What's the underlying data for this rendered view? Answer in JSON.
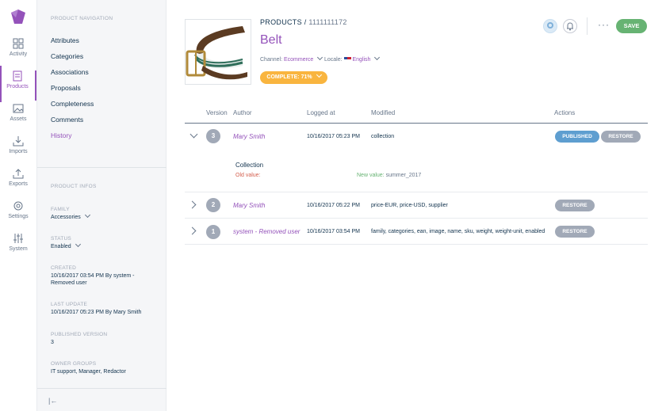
{
  "mainmenu": {
    "items": [
      {
        "label": "Activity",
        "icon": "dashboard-icon"
      },
      {
        "label": "Products",
        "icon": "products-icon"
      },
      {
        "label": "Assets",
        "icon": "image-icon"
      },
      {
        "label": "Imports",
        "icon": "download-icon"
      },
      {
        "label": "Exports",
        "icon": "upload-icon"
      },
      {
        "label": "Settings",
        "icon": "gear-icon"
      },
      {
        "label": "System",
        "icon": "sliders-icon"
      }
    ],
    "accent": "#9452ba"
  },
  "colnav": {
    "nav_title": "PRODUCT NAVIGATION",
    "links": [
      "Attributes",
      "Categories",
      "Associations",
      "Proposals",
      "Completeness",
      "Comments",
      "History"
    ],
    "infos_title": "PRODUCT INFOS",
    "family_label": "FAMILY",
    "family_value": "Accessories",
    "status_label": "STATUS",
    "status_value": "Enabled",
    "created_label": "CREATED",
    "created_value": "10/16/2017 03:54 PM By system - Removed user",
    "update_label": "LAST UPDATE",
    "update_value": "10/16/2017 05:23 PM By Mary Smith",
    "published_label": "PUBLISHED VERSION",
    "published_value": "3",
    "owner_label": "OWNER GROUPS",
    "owner_value": "IT support, Manager, Redactor",
    "collapse_glyph": "|←"
  },
  "header": {
    "crumb_root": "PRODUCTS",
    "crumb_sep": " / ",
    "crumb_id": "1111111172",
    "title": "Belt",
    "channel_label": "Channel: ",
    "channel_value": "Ecommerce",
    "locale_label": "Locale: ",
    "locale_value": "English",
    "complete_label": "COMPLETE: 71%",
    "more_glyph": "···",
    "save_label": "SAVE"
  },
  "table": {
    "headers": {
      "version": "Version",
      "author": "Author",
      "logged": "Logged at",
      "modified": "Modified",
      "actions": "Actions"
    },
    "rows": [
      {
        "version": "3",
        "author": "Mary Smith",
        "logged": "10/16/2017 05:23 PM",
        "modified": "collection",
        "published": "PUBLISHED",
        "restore": "RESTORE"
      },
      {
        "version": "2",
        "author": "Mary Smith",
        "logged": "10/16/2017 05:22 PM",
        "modified": "price-EUR, price-USD, supplier",
        "restore": "RESTORE"
      },
      {
        "version": "1",
        "author": "system - Removed user",
        "logged": "10/16/2017 03:54 PM",
        "modified": "family, categories, ean, image, name, sku, weight, weight-unit, enabled",
        "restore": "RESTORE"
      }
    ],
    "detail": {
      "field": "Collection",
      "old_label": "Old value:",
      "new_label": "New value: ",
      "new_value": "summer_2017"
    }
  }
}
